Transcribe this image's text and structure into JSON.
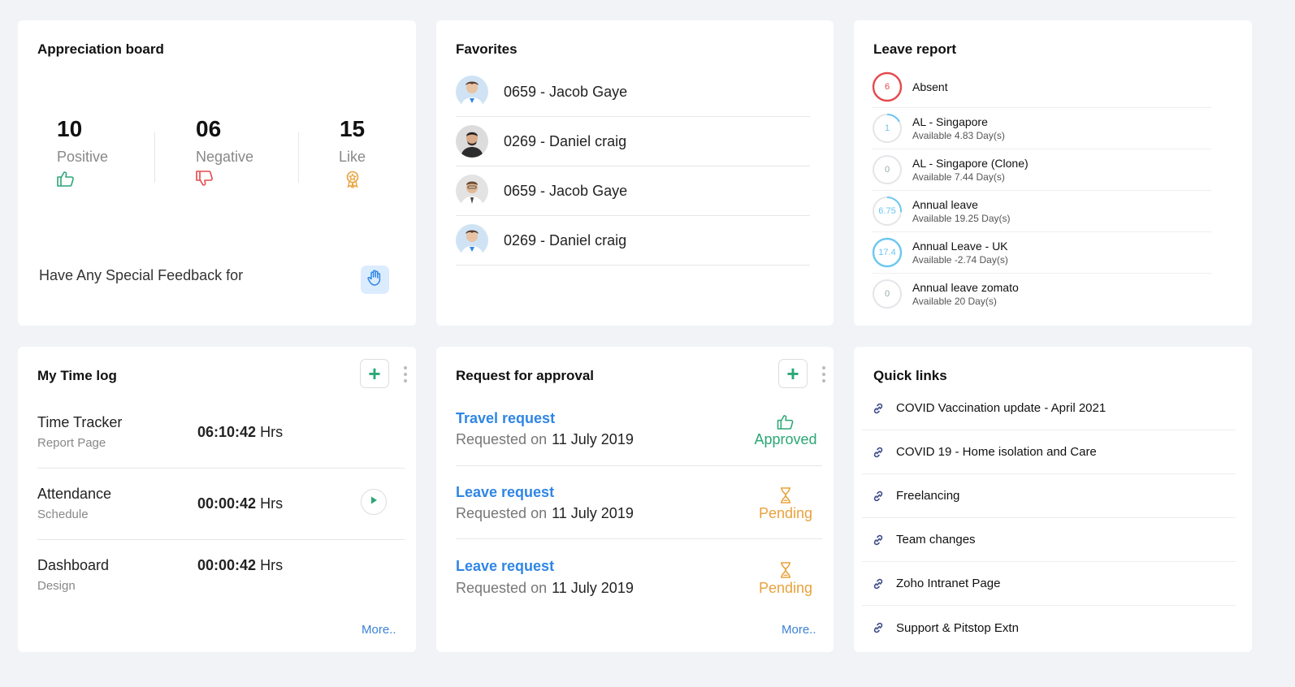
{
  "appreciation": {
    "title": "Appreciation board",
    "stats": [
      {
        "value": "10",
        "label": "Positive",
        "icon": "thumbs-up-icon",
        "color": "#2aa776"
      },
      {
        "value": "06",
        "label": "Negative",
        "icon": "thumbs-down-icon",
        "color": "#e5484d"
      },
      {
        "value": "15",
        "label": "Like",
        "icon": "award-badge-icon",
        "color": "#e9a23b"
      }
    ],
    "feedback_text": "Have Any Special Feedback for",
    "feedback_icon": "waving-hand-icon"
  },
  "favorites": {
    "title": "Favorites",
    "items": [
      {
        "name": "0659 - Jacob Gaye"
      },
      {
        "name": "0269 - Daniel craig"
      },
      {
        "name": "0659 - Jacob Gaye"
      },
      {
        "name": "0269 - Daniel craig"
      }
    ]
  },
  "leave_report": {
    "title": "Leave report",
    "items": [
      {
        "value": "6",
        "name": "Absent",
        "sub": "",
        "color": "#e5484d",
        "fraction": 1.0
      },
      {
        "value": "1",
        "name": "AL - Singapore",
        "sub": "Available 4.83 Day(s)",
        "color": "#6cc7f0",
        "fraction": 0.17
      },
      {
        "value": "0",
        "name": "AL - Singapore (Clone)",
        "sub": "Available 7.44 Day(s)",
        "color": "#cfd4da",
        "fraction": 0
      },
      {
        "value": "6.75",
        "name": "Annual leave",
        "sub": "Available 19.25 Day(s)",
        "color": "#6cc7f0",
        "fraction": 0.26
      },
      {
        "value": "17.4",
        "name": "Annual Leave - UK",
        "sub": "Available -2.74 Day(s)",
        "color": "#6cc7f0",
        "fraction": 1.0
      },
      {
        "value": "0",
        "name": "Annual leave zomato",
        "sub": "Available 20 Day(s)",
        "color": "#cfd4da",
        "fraction": 0
      }
    ]
  },
  "time_log": {
    "title": "My Time log",
    "unit": "Hrs",
    "rows": [
      {
        "name": "Time Tracker",
        "sub": "Report Page",
        "time": "06:10:42"
      },
      {
        "name": "Attendance",
        "sub": "Schedule",
        "time": "00:00:42"
      },
      {
        "name": "Dashboard",
        "sub": "Design",
        "time": "00:00:42"
      }
    ],
    "more": "More.."
  },
  "approval": {
    "title": "Request for approval",
    "requested_on": "Requested on",
    "rows": [
      {
        "title": "Travel request",
        "date": "11 July  2019",
        "status": "Approved",
        "status_color": "#2aa776",
        "status_icon": "thumbs-up-icon"
      },
      {
        "title": "Leave request",
        "date": "11 July  2019",
        "status": "Pending",
        "status_color": "#e9a23b",
        "status_icon": "hourglass-icon"
      },
      {
        "title": "Leave request",
        "date": "11 July  2019",
        "status": "Pending",
        "status_color": "#e9a23b",
        "status_icon": "hourglass-icon"
      }
    ],
    "more": "More.."
  },
  "quick_links": {
    "title": "Quick links",
    "items": [
      {
        "label": "COVID Vaccination update - April 2021"
      },
      {
        "label": "COVID 19 - Home isolation and Care"
      },
      {
        "label": "Freelancing"
      },
      {
        "label": "Team changes"
      },
      {
        "label": "Zoho Intranet Page"
      },
      {
        "label": "Support & Pitstop Extn"
      }
    ]
  }
}
